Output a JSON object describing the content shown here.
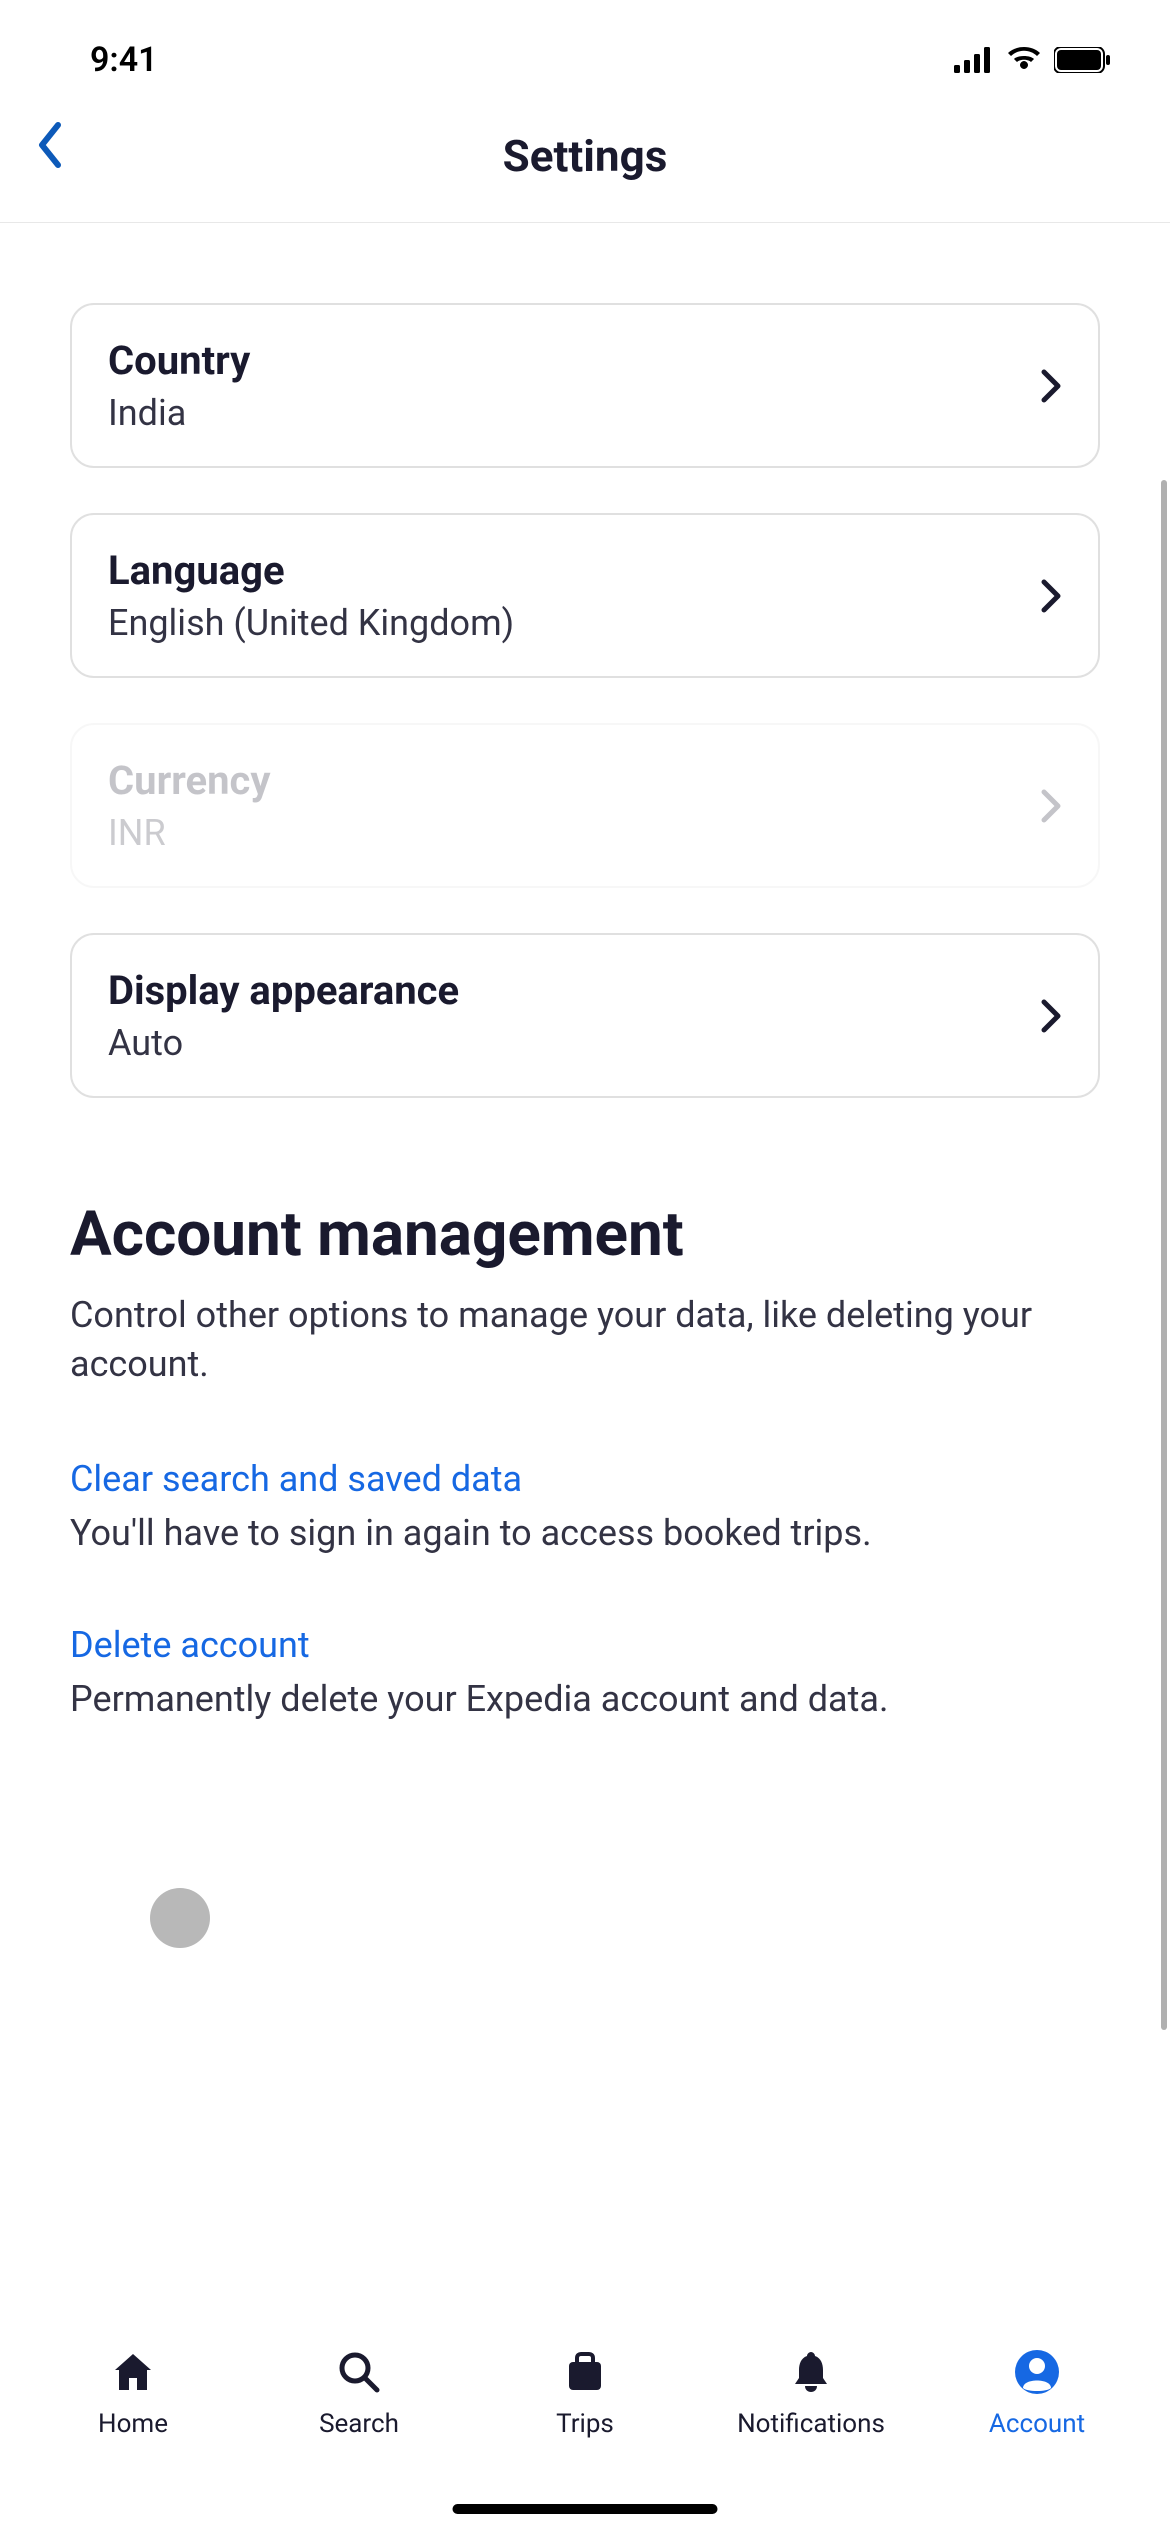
{
  "statusBar": {
    "time": "9:41"
  },
  "nav": {
    "title": "Settings"
  },
  "settings": {
    "country": {
      "title": "Country",
      "value": "India"
    },
    "language": {
      "title": "Language",
      "value": "English (United Kingdom)"
    },
    "currency": {
      "title": "Currency",
      "value": "INR"
    },
    "displayAppearance": {
      "title": "Display appearance",
      "value": "Auto"
    }
  },
  "accountManagement": {
    "heading": "Account management",
    "description": "Control other options to manage your data, like deleting your account.",
    "clearData": {
      "title": "Clear search and saved data",
      "description": "You'll have to sign in again to access booked trips."
    },
    "deleteAccount": {
      "title": "Delete account",
      "description": "Permanently delete your Expedia account and data."
    }
  },
  "tabs": {
    "home": "Home",
    "search": "Search",
    "trips": "Trips",
    "notifications": "Notifications",
    "account": "Account"
  }
}
